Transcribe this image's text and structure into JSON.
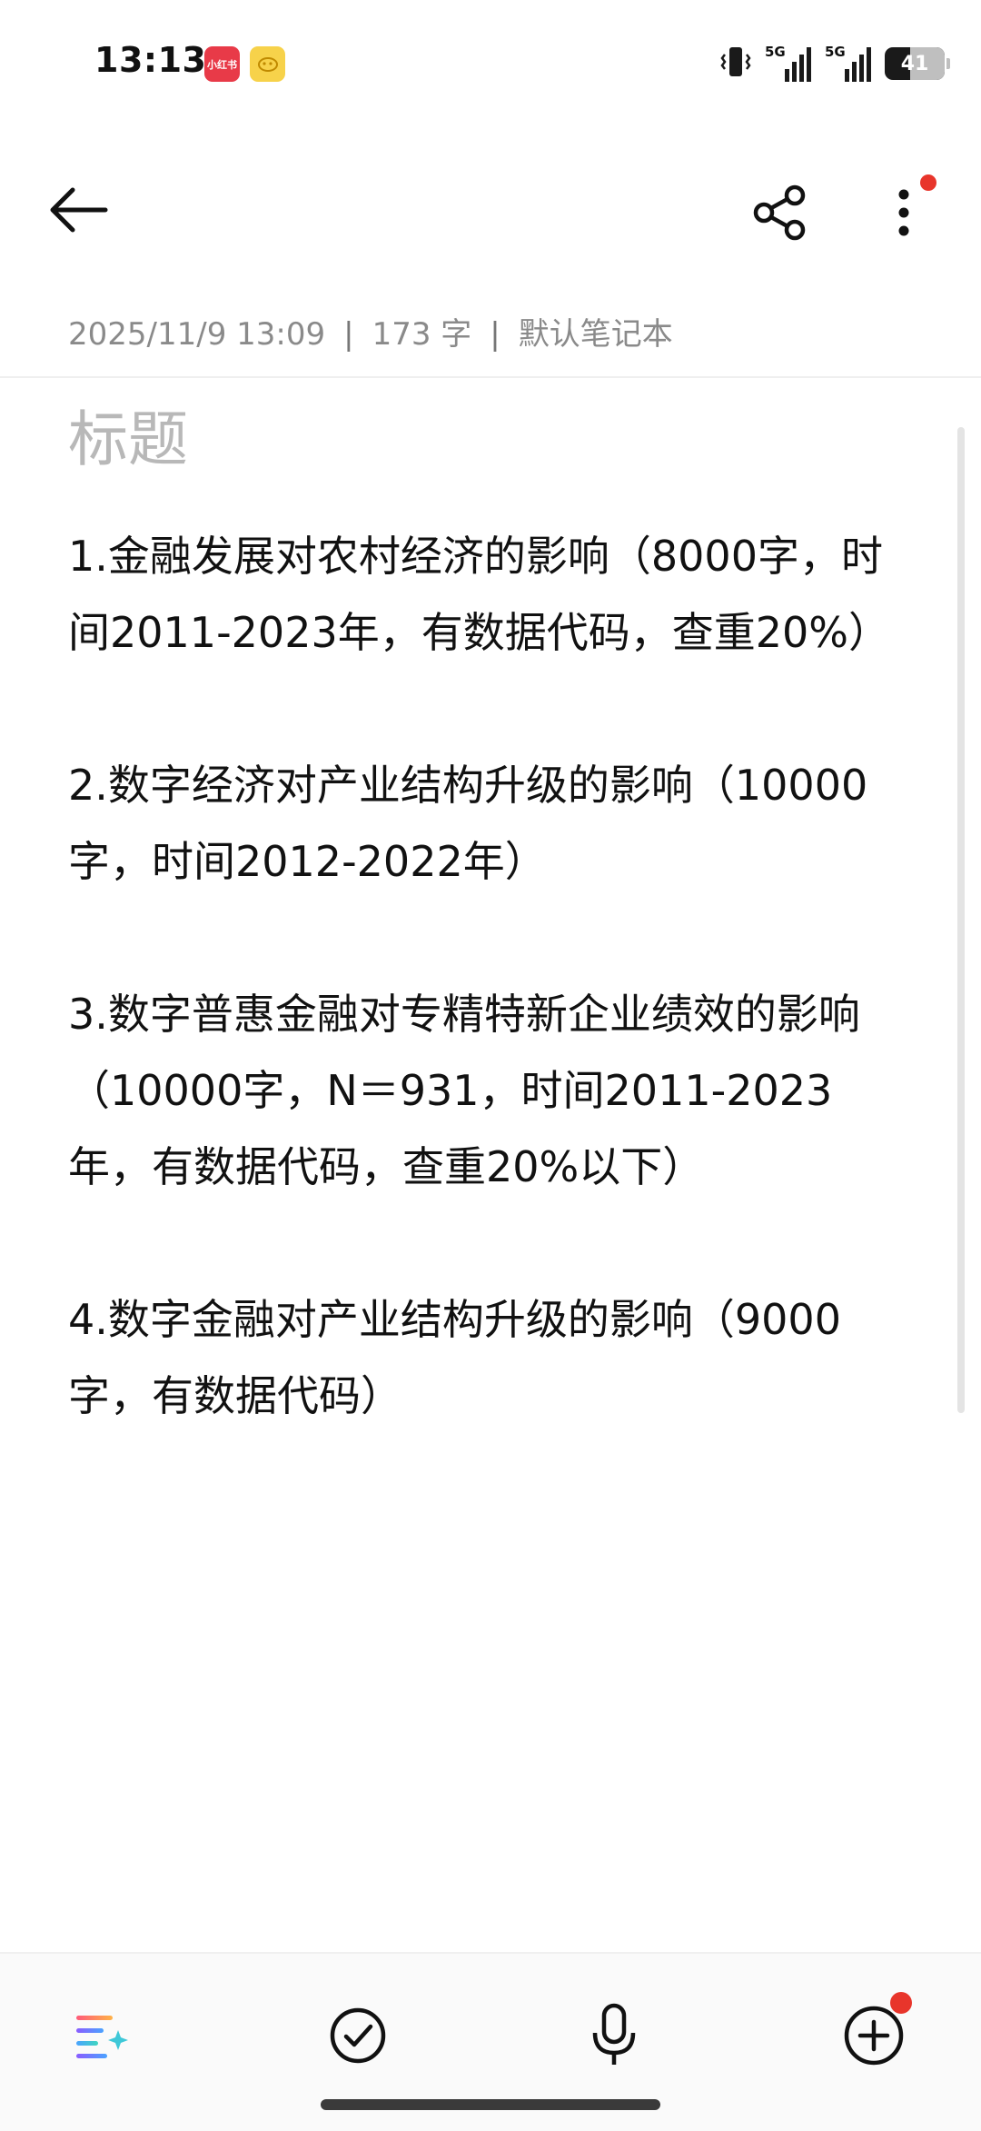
{
  "status_bar": {
    "time": "13:13",
    "notification_xhs_label": "小红书",
    "network_1": "5G",
    "network_2": "5G",
    "battery_level": "41"
  },
  "toolbar": {
    "back_icon": "arrow-left-icon",
    "share_icon": "share-icon",
    "more_icon": "more-vertical-icon",
    "accent_dot_color": "#e8352b"
  },
  "meta": {
    "datetime": "2025/11/9 13:09",
    "separator": "|",
    "word_count": "173 字",
    "notebook": "默认笔记本"
  },
  "note": {
    "title_placeholder": "标题",
    "paragraphs": [
      "1.金融发展对农村经济的影响（8000字，时间2011-2023年，有数据代码，查重20%）",
      "2.数字经济对产业结构升级的影响（10000字，时间2012-2022年）",
      "3.数字普惠金融对专精特新企业绩效的影响（10000字，N＝931，时间2011-2023年，有数据代码，查重20%以下）",
      "4.数字金融对产业结构升级的影响（9000字，有数据代码）"
    ]
  },
  "bottom_bar": {
    "ai_icon": "ai-format-icon",
    "todo_icon": "checkmark-circle-icon",
    "voice_icon": "microphone-icon",
    "add_icon": "add-circle-icon"
  }
}
